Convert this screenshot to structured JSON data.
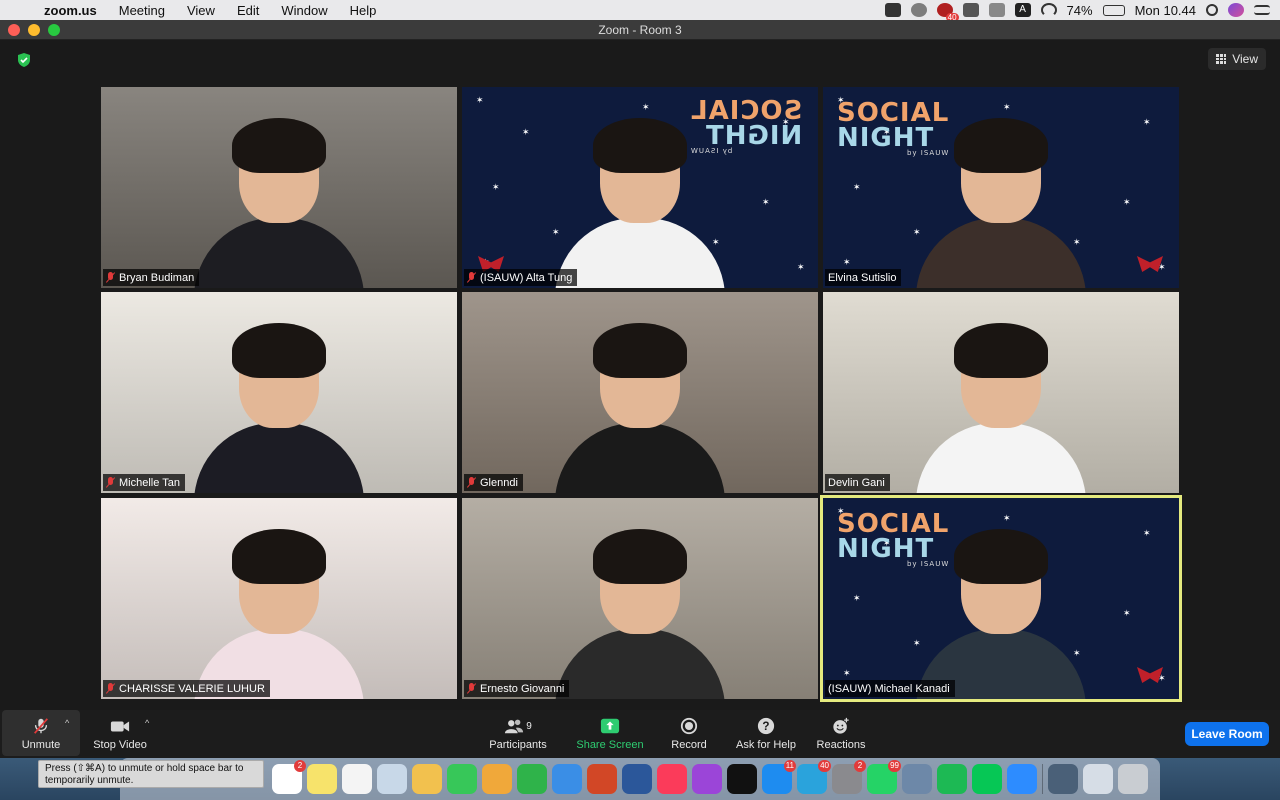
{
  "menubar": {
    "app_name": "zoom.us",
    "menus": [
      "Meeting",
      "View",
      "Edit",
      "Window",
      "Help"
    ],
    "status": {
      "battery": "74%",
      "clock": "Mon 10.44",
      "badge_count": "40"
    }
  },
  "window": {
    "title": "Zoom - Room 3"
  },
  "view_button": {
    "label": "View"
  },
  "participants": [
    {
      "name": "Bryan Budiman",
      "muted": true,
      "bg": "#6f6a63",
      "body": "#1d1d22",
      "bg_kind": "room"
    },
    {
      "name": "(ISAUW) Alta Tung",
      "muted": true,
      "bg": "#0e1b3d",
      "body": "#f2f2f2",
      "bg_kind": "social-mirrored"
    },
    {
      "name": "Elvina Sutislio",
      "muted": false,
      "bg": "#0e1b3d",
      "body": "#3c2f2a",
      "bg_kind": "social"
    },
    {
      "name": "Michelle Tan",
      "muted": true,
      "bg": "#e8e4dc",
      "body": "#1c1c24",
      "bg_kind": "shelf"
    },
    {
      "name": "Glenndi",
      "muted": true,
      "bg": "#8a7e72",
      "body": "#1a1a1a",
      "bg_kind": "room"
    },
    {
      "name": "Devlin Gani",
      "muted": false,
      "bg": "#d9d4c8",
      "body": "#f4f4f4",
      "bg_kind": "room"
    },
    {
      "name": "CHARISSE VALERIE LUHUR",
      "muted": true,
      "bg": "#efe6e2",
      "body": "#f1dfe4",
      "bg_kind": "room"
    },
    {
      "name": "Ernesto Giovanni",
      "muted": true,
      "bg": "#a49c90",
      "body": "#2a2a2a",
      "bg_kind": "room"
    },
    {
      "name": "(ISAUW) Michael Kanadi",
      "muted": false,
      "bg": "#0e1b3d",
      "body": "#2a3540",
      "bg_kind": "social",
      "active": true
    }
  ],
  "social_logo": {
    "line1": "SOCIAL",
    "line2": "NIGHT",
    "line3": "by ISAUW"
  },
  "toolbar": {
    "unmute": "Unmute",
    "stop_video": "Stop Video",
    "participants": "Participants",
    "participants_count": "9",
    "share_screen": "Share Screen",
    "record": "Record",
    "ask_help": "Ask for Help",
    "reactions": "Reactions",
    "leave": "Leave Room"
  },
  "tooltip": {
    "line1": "Press  (⇧⌘A) to unmute or hold space bar to",
    "line2": "temporarily unmute."
  },
  "dock": {
    "apps": [
      {
        "name": "calendar",
        "color": "#ffffff",
        "badge": "2"
      },
      {
        "name": "notes",
        "color": "#f7e36b",
        "badge": ""
      },
      {
        "name": "reminders",
        "color": "#f4f4f4",
        "badge": ""
      },
      {
        "name": "preview",
        "color": "#c8d8e8",
        "badge": ""
      },
      {
        "name": "photos",
        "color": "#f2c14e",
        "badge": ""
      },
      {
        "name": "facetime",
        "color": "#37c759",
        "badge": ""
      },
      {
        "name": "pages",
        "color": "#f0a83a",
        "badge": ""
      },
      {
        "name": "numbers",
        "color": "#2fb34a",
        "badge": ""
      },
      {
        "name": "keynote",
        "color": "#3a8ee6",
        "badge": ""
      },
      {
        "name": "powerpoint",
        "color": "#d24726",
        "badge": ""
      },
      {
        "name": "word",
        "color": "#2b579a",
        "badge": ""
      },
      {
        "name": "music",
        "color": "#fb3b5a",
        "badge": ""
      },
      {
        "name": "podcasts",
        "color": "#9b45d8",
        "badge": ""
      },
      {
        "name": "apple-tv",
        "color": "#111111",
        "badge": ""
      },
      {
        "name": "app-store",
        "color": "#1e8cf0",
        "badge": "11"
      },
      {
        "name": "telegram",
        "color": "#2aa3dc",
        "badge": "40"
      },
      {
        "name": "system-preferences",
        "color": "#8a8a8e",
        "badge": "2"
      },
      {
        "name": "whatsapp",
        "color": "#25d366",
        "badge": "99"
      },
      {
        "name": "image-capture",
        "color": "#6d88a8",
        "badge": ""
      },
      {
        "name": "spotify",
        "color": "#1db954",
        "badge": ""
      },
      {
        "name": "line",
        "color": "#06c755",
        "badge": ""
      },
      {
        "name": "zoom",
        "color": "#2d8cff",
        "badge": ""
      }
    ],
    "extras": [
      {
        "name": "downloads-folder",
        "color": "#4a6078"
      },
      {
        "name": "stack",
        "color": "#d6dde6"
      },
      {
        "name": "trash",
        "color": "#c9cdd2"
      }
    ]
  }
}
